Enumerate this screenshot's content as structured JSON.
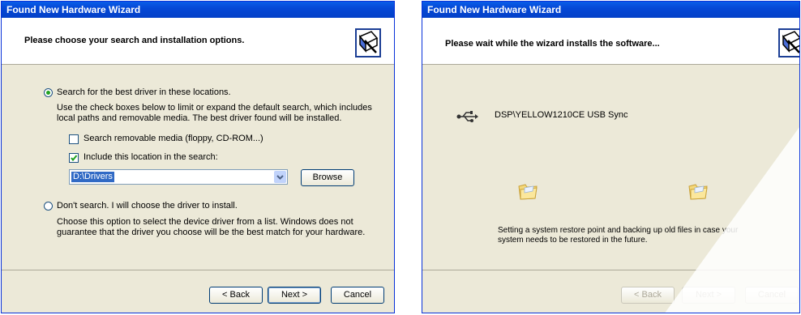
{
  "left": {
    "title": "Found New Hardware Wizard",
    "header": "Please choose your search and installation options.",
    "option_search": "Search for the best driver in these locations.",
    "search_desc": "Use the check boxes below to limit or expand the default search, which includes local paths and removable media. The best driver found will be installed.",
    "check_removable": "Search removable media (floppy, CD-ROM...)",
    "check_location": "Include this location in the search:",
    "path_value": "D:\\Drivers",
    "browse_label": "Browse",
    "option_dont": "Don't search. I will choose the driver to install.",
    "dont_desc": "Choose this option to select the device driver from a list.  Windows does not guarantee that the driver you choose will be the best match for your hardware.",
    "back_label": "< Back",
    "next_label": "Next >",
    "cancel_label": "Cancel"
  },
  "right": {
    "title": "Found New Hardware Wizard",
    "header": "Please wait while the wizard installs the software...",
    "device_name": "DSP\\YELLOW1210CE USB Sync",
    "status_text": "Setting a system restore point and backing up old files in case your system needs to be restored in the future.",
    "back_label": "< Back",
    "next_label": "Next >",
    "cancel_label": "Cancel"
  }
}
